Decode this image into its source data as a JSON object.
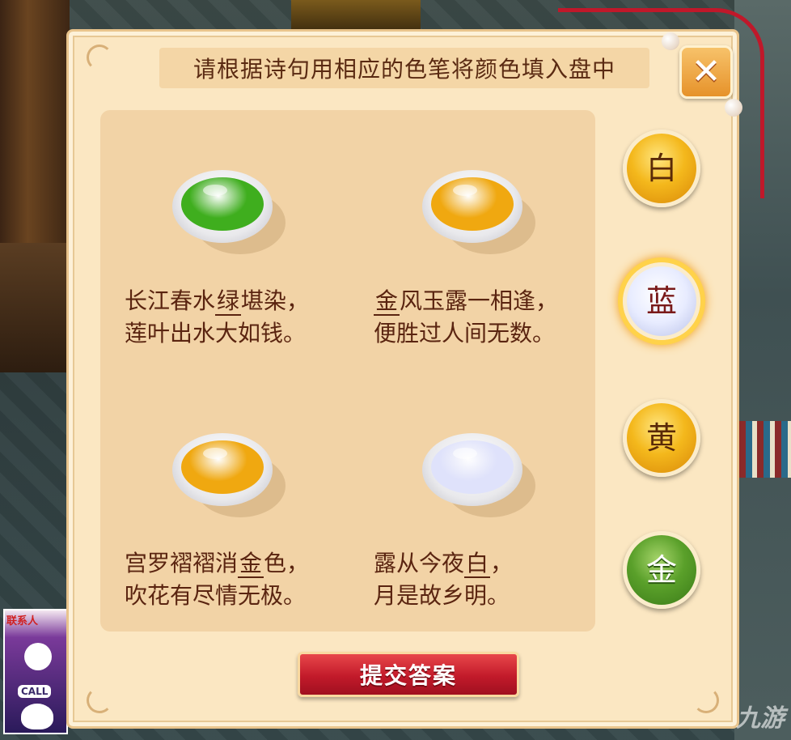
{
  "title": "请根据诗句用相应的色笔将颜色填入盘中",
  "close_icon": "close-x-icon",
  "bowls": [
    {
      "color": "#3fae1e",
      "color_name": "green"
    },
    {
      "color": "#f0a810",
      "color_name": "gold"
    },
    {
      "color": "#f0a810",
      "color_name": "gold"
    },
    {
      "color": "#dfe2fb",
      "color_name": "white"
    }
  ],
  "poems": [
    {
      "line1_pre": "长江春水",
      "answer": "绿",
      "line1_post": "堪染，",
      "line2": "莲叶出水大如钱。"
    },
    {
      "line1_pre": "",
      "answer": "金",
      "line1_post": "风玉露一相逢，",
      "line2": "便胜过人间无数。"
    },
    {
      "line1_pre": "宫罗褶褶消",
      "answer": "金",
      "line1_post": "色，",
      "line2": "吹花有尽情无极。"
    },
    {
      "line1_pre": "露从今夜",
      "answer": "白",
      "line1_post": "，",
      "line2": "月是故乡明。"
    }
  ],
  "pens": [
    {
      "label": "白",
      "style": "gold",
      "selected": false
    },
    {
      "label": "蓝",
      "style": "silver",
      "selected": true
    },
    {
      "label": "黄",
      "style": "gold",
      "selected": false
    },
    {
      "label": "金",
      "style": "green",
      "selected": false
    }
  ],
  "submit_label": "提交答案",
  "avatar": {
    "tag": "联系人",
    "call": "CALL"
  },
  "watermark": "九游",
  "colors": {
    "panel": "#fbe7c2",
    "content": "#f2d3a6",
    "text": "#5a2410",
    "submit": "#c21a2a"
  }
}
